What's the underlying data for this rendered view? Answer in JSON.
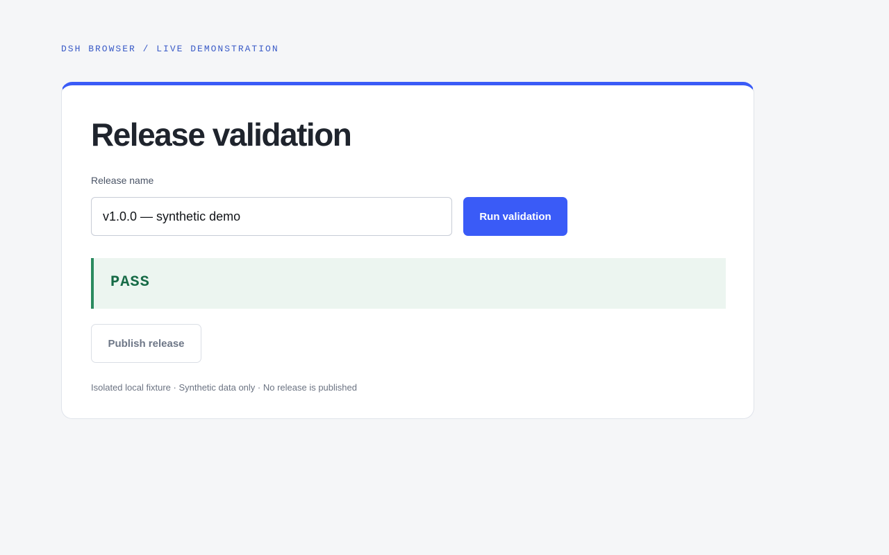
{
  "header": {
    "kicker": "DSH BROWSER / LIVE DEMONSTRATION"
  },
  "card": {
    "title": "Release validation",
    "field_label": "Release name",
    "input_value": "v1.0.0 — synthetic demo",
    "run_button_label": "Run validation",
    "status": "PASS",
    "publish_button_label": "Publish release",
    "footnote": "Isolated local fixture · Synthetic data only · No release is published"
  },
  "colors": {
    "accent": "#3a5bf7",
    "pass": "#176b47",
    "pass_background": "#ecf5f0",
    "page_background": "#f5f6f8"
  }
}
